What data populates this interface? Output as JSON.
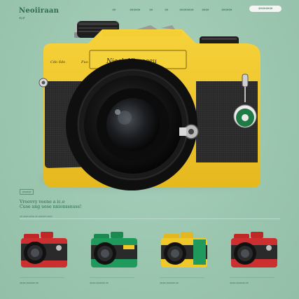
{
  "header": {
    "brand": "Neoiiraan",
    "tagline": "ॻ॔ॡ ॹॕ",
    "nav": [
      "ॶॼ",
      "ॶॼॶॼॶॼ",
      "ॶॼ",
      "ॶॼ",
      "ॶॼॶॼॶॼॶॼ",
      "ॶॼॶॼ",
      "ॶॼॶॼॶॼ"
    ],
    "cta": "ॶॼॶॼॶॼॶॼ"
  },
  "hero": {
    "camera_script": "Nieeh Ulereeeu",
    "camera_left_mark": "Cdo Ѕdo",
    "camera_right_mark": "Fuo",
    "body_color": "#f2c92a",
    "leather_color": "#2a2a2a"
  },
  "section": {
    "badge": "ॶॼॶॼॶॼ",
    "headline_1": "Vroovvy veene a ic.e",
    "headline_2": "Cuse ang uese nnionssnuss!",
    "subline": "ॶॼ ॶॼॶॼ ॶॼॶॼ ॶॼ ॶॼॶॼॶॼ ॶॼॶॼ"
  },
  "products": [
    {
      "color": "#cc2f2f",
      "caption": "ॶॼॶॼ ॶॼॶॼॶॼ ॶॼ"
    },
    {
      "color": "#1f9a5c",
      "caption": "ॶॼॶॼ ॶॼॶॼॶॼ ॶॼ"
    },
    {
      "color": "#f0c829",
      "caption": "ॶॼॶॼ ॶॼॶॼॶॼ ॶॼ"
    },
    {
      "color": "#cc2f2f",
      "caption": "ॶॼॶॼ ॶॼॶॼॶॼ ॶॼ"
    }
  ]
}
